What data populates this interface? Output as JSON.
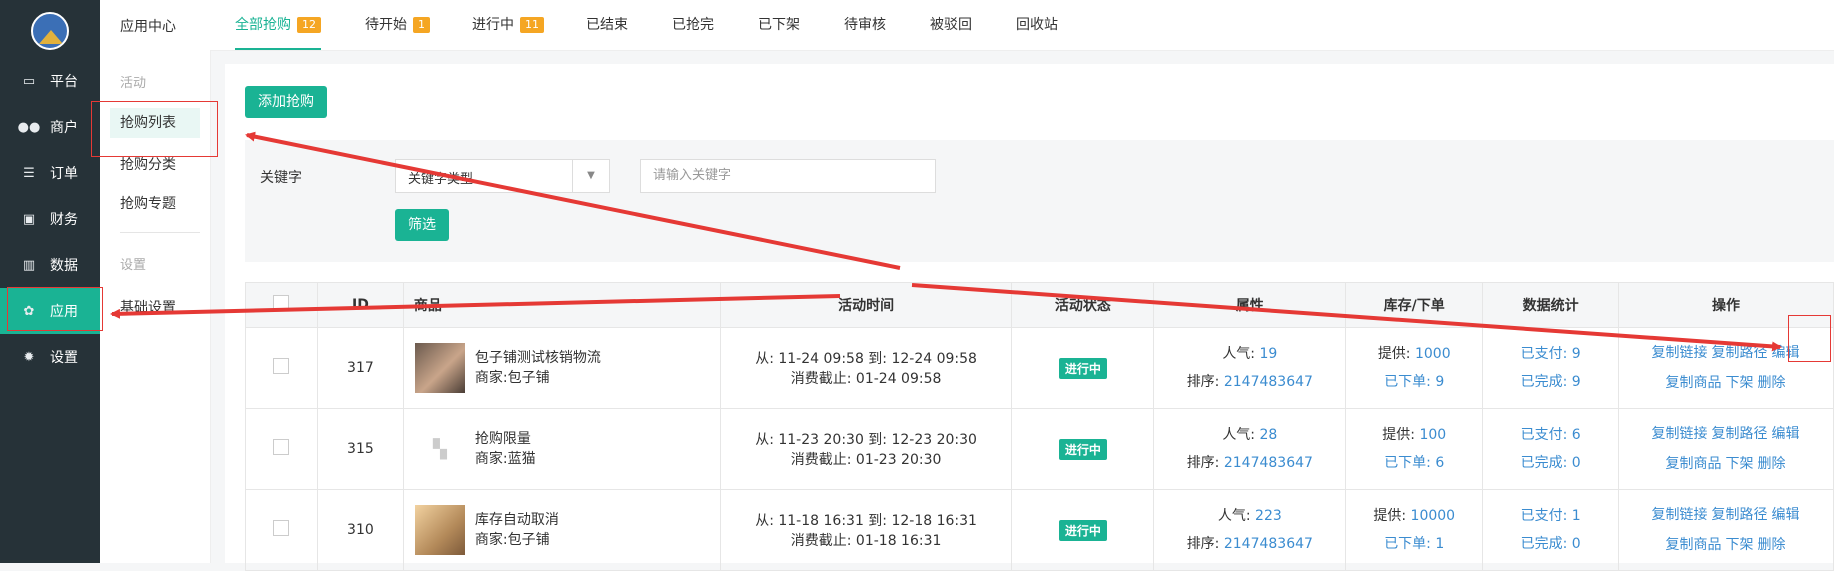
{
  "sidebar": {
    "items": [
      {
        "label": "平台",
        "icon": "monitor-icon"
      },
      {
        "label": "商户",
        "icon": "users-icon"
      },
      {
        "label": "订单",
        "icon": "list-icon"
      },
      {
        "label": "财务",
        "icon": "money-icon"
      },
      {
        "label": "数据",
        "icon": "chart-icon"
      },
      {
        "label": "应用",
        "icon": "apps-icon",
        "active": true
      },
      {
        "label": "设置",
        "icon": "gear-icon"
      }
    ]
  },
  "subnav": {
    "title": "应用中心",
    "group1": "活动",
    "items": [
      "抢购列表",
      "抢购分类",
      "抢购专题"
    ],
    "group2": "设置",
    "settings_item": "基础设置"
  },
  "tabs": [
    {
      "label": "全部抢购",
      "badge": "12",
      "active": true
    },
    {
      "label": "待开始",
      "badge": "1"
    },
    {
      "label": "进行中",
      "badge": "11"
    },
    {
      "label": "已结束"
    },
    {
      "label": "已抢完"
    },
    {
      "label": "已下架"
    },
    {
      "label": "待审核"
    },
    {
      "label": "被驳回"
    },
    {
      "label": "回收站"
    }
  ],
  "toolbar": {
    "add_label": "添加抢购"
  },
  "filter": {
    "keyword_label": "关键字",
    "type_select": "关键字类型",
    "keyword_placeholder": "请输入关键字",
    "filter_button": "筛选"
  },
  "table": {
    "headers": [
      "ID",
      "商品",
      "活动时间",
      "活动状态",
      "属性",
      "库存/下单",
      "数据统计",
      "操作"
    ],
    "rows": [
      {
        "id": "317",
        "name": "包子铺测试核销物流",
        "merchant": "商家:包子铺",
        "time1": "从: 11-24 09:58  到: 12-24 09:58",
        "time2": "消费截止: 01-24 09:58",
        "status": "进行中",
        "pop_label": "人气:",
        "pop": "19",
        "sort_label": "排序:",
        "sort": "2147483647",
        "supply_label": "提供:",
        "supply": "1000",
        "ordered": "已下单: 9",
        "paid": "已支付: 9",
        "done": "已完成: 9"
      },
      {
        "id": "315",
        "name": "抢购限量",
        "merchant": "商家:蓝猫",
        "time1": "从: 11-23 20:30  到: 12-23 20:30",
        "time2": "消费截止: 01-23 20:30",
        "status": "进行中",
        "pop_label": "人气:",
        "pop": "28",
        "sort_label": "排序:",
        "sort": "2147483647",
        "supply_label": "提供:",
        "supply": "100",
        "ordered": "已下单: 6",
        "paid": "已支付: 6",
        "done": "已完成: 0"
      },
      {
        "id": "310",
        "name": "库存自动取消",
        "merchant": "商家:包子铺",
        "time1": "从: 11-18 16:31  到: 12-18 16:31",
        "time2": "消费截止: 01-18 16:31",
        "status": "进行中",
        "pop_label": "人气:",
        "pop": "223",
        "sort_label": "排序:",
        "sort": "2147483647",
        "supply_label": "提供:",
        "supply": "10000",
        "ordered": "已下单: 1",
        "paid": "已支付: 1",
        "done": "已完成: 0"
      }
    ],
    "ops": {
      "copy_link": "复制链接",
      "copy_path": "复制路径",
      "edit": "编辑",
      "copy_goods": "复制商品",
      "offline": "下架",
      "delete": "删除"
    }
  },
  "colors": {
    "accent": "#1ab394",
    "sidebar": "#263238",
    "link": "#3b8cd0",
    "badge": "#f5a623",
    "annotation": "#e53935"
  }
}
